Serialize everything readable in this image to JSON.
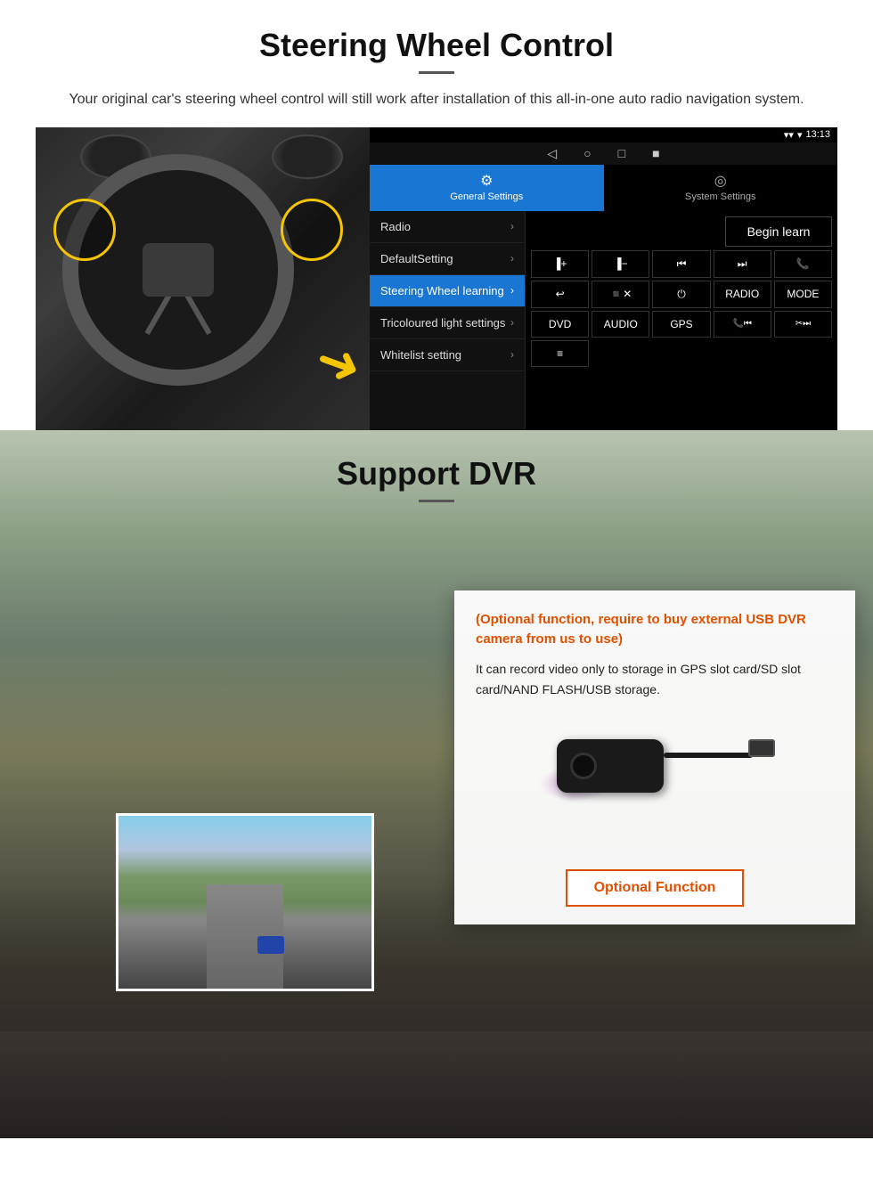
{
  "steering_section": {
    "title": "Steering Wheel Control",
    "subtitle": "Your original car's steering wheel control will still work after installation of this all-in-one auto radio navigation system.",
    "android_ui": {
      "status_bar": {
        "signal_icon": "▼",
        "wifi_icon": "▾",
        "time": "13:13"
      },
      "nav_icons": [
        "◁",
        "○",
        "□",
        "■"
      ],
      "tabs": [
        {
          "label": "General Settings",
          "icon": "⚙",
          "active": true
        },
        {
          "label": "System Settings",
          "icon": "◎",
          "active": false
        }
      ],
      "menu_items": [
        {
          "label": "Radio",
          "active": false
        },
        {
          "label": "DefaultSetting",
          "active": false
        },
        {
          "label": "Steering Wheel learning",
          "active": true
        },
        {
          "label": "Tricoloured light settings",
          "active": false
        },
        {
          "label": "Whitelist setting",
          "active": false
        }
      ],
      "begin_learn_label": "Begin learn",
      "control_buttons": [
        {
          "label": "▐+"
        },
        {
          "label": "▐−"
        },
        {
          "label": "⏮"
        },
        {
          "label": "⏭"
        },
        {
          "label": "📞"
        },
        {
          "label": "↩"
        },
        {
          "label": "◾✕"
        },
        {
          "label": "⏻"
        },
        {
          "label": "RADIO"
        },
        {
          "label": "MODE"
        },
        {
          "label": "DVD"
        },
        {
          "label": "AUDIO"
        },
        {
          "label": "GPS"
        },
        {
          "label": "📞⏮"
        },
        {
          "label": "✂⏭"
        },
        {
          "label": "≡"
        }
      ]
    }
  },
  "dvr_section": {
    "title": "Support DVR",
    "optional_text": "(Optional function, require to buy external USB DVR camera from us to use)",
    "description": "It can record video only to storage in GPS slot card/SD slot card/NAND FLASH/USB storage.",
    "optional_function_button": "Optional Function"
  }
}
